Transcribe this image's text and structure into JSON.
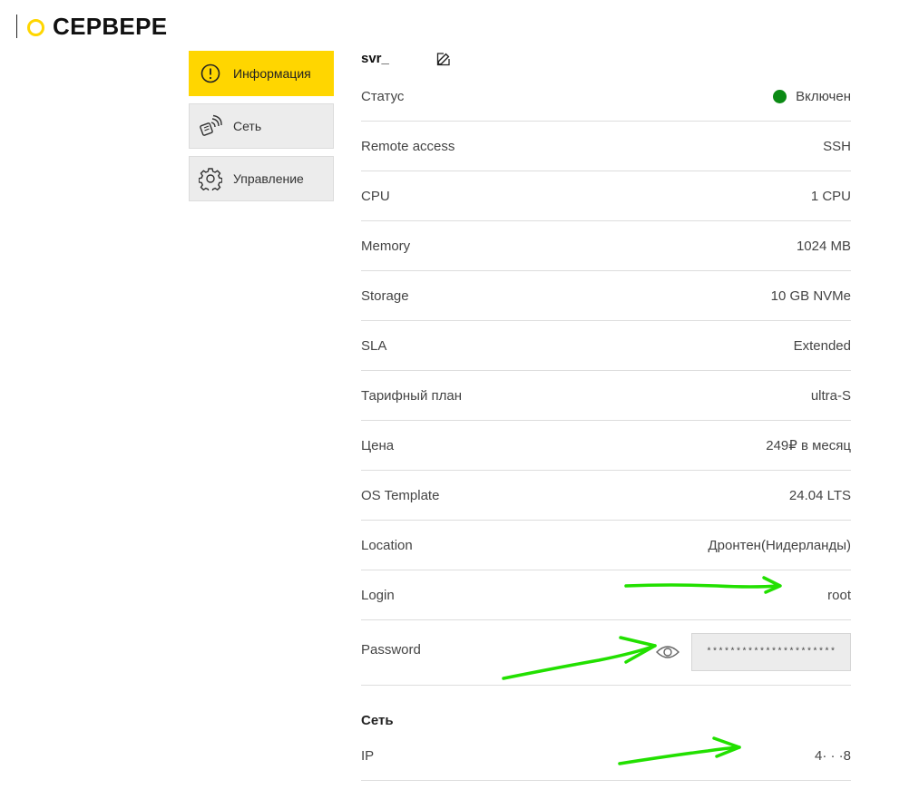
{
  "header": {
    "title": "СЕРВЕРЕ",
    "accent_color": "#ffd600"
  },
  "sidebar": {
    "items": [
      {
        "label": "Информация",
        "icon": "info-circle-icon",
        "active": true
      },
      {
        "label": "Сеть",
        "icon": "network-icon",
        "active": false
      },
      {
        "label": "Управление",
        "icon": "gear-icon",
        "active": false
      }
    ]
  },
  "server": {
    "name": "svr_",
    "rows": [
      {
        "label": "Статус",
        "value": "Включен",
        "status_color": "#0b8a14"
      },
      {
        "label": "Remote access",
        "value": "SSH"
      },
      {
        "label": "CPU",
        "value": "1 CPU"
      },
      {
        "label": "Memory",
        "value": "1024 MB"
      },
      {
        "label": "Storage",
        "value": "10 GB NVMe"
      },
      {
        "label": "SLA",
        "value": "Extended"
      },
      {
        "label": "Тарифный план",
        "value": "ultra-S"
      },
      {
        "label": "Цена",
        "value": "249₽ в месяц"
      },
      {
        "label": "OS Template",
        "value": "24.04 LTS"
      },
      {
        "label": "Location",
        "value": "Дронтен(Нидерланды)"
      },
      {
        "label": "Login",
        "value": "root"
      }
    ],
    "password": {
      "label": "Password",
      "masked_value": "**********************"
    }
  },
  "network": {
    "title": "Сеть",
    "ip_label": "IP",
    "ip_value": "4·  ·   ·8"
  },
  "annotations": {
    "arrow_color": "#22e000"
  }
}
